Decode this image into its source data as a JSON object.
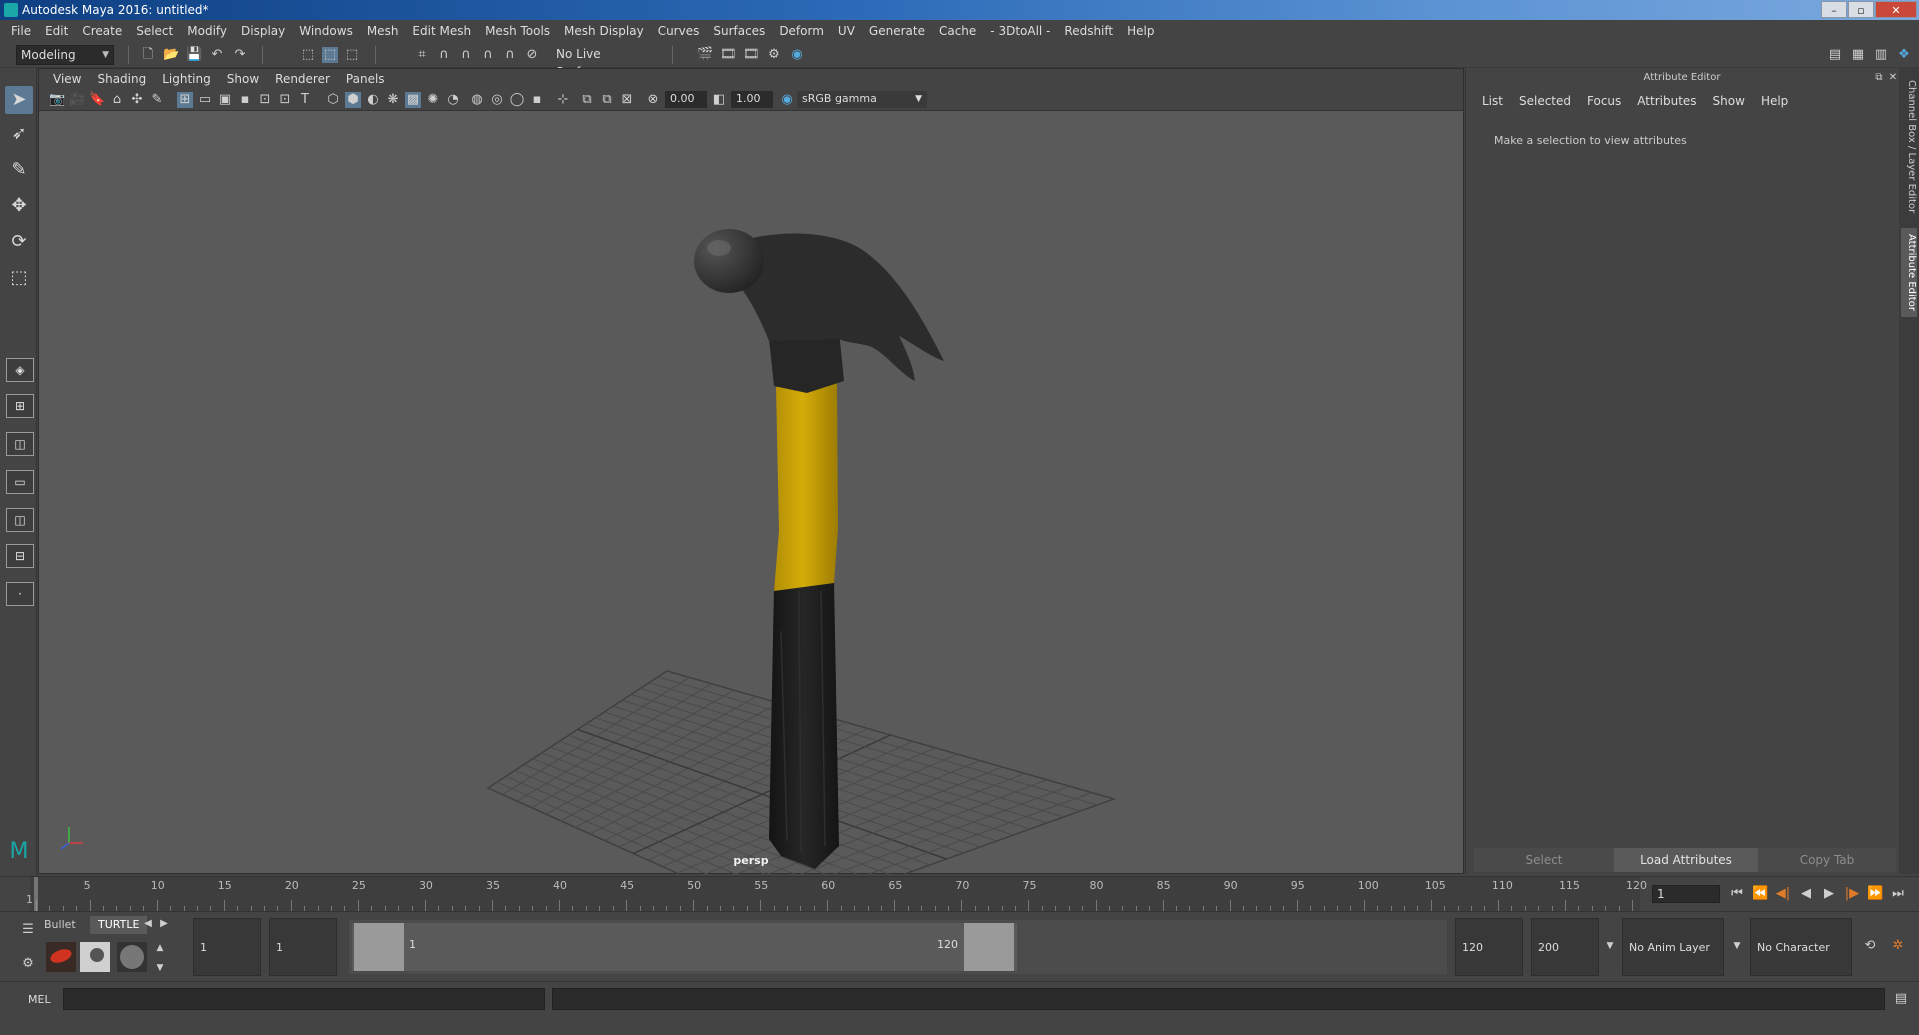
{
  "window": {
    "title": "Autodesk Maya 2016: untitled*",
    "buttons": [
      "–",
      "▫",
      "✕"
    ]
  },
  "menubar": [
    "File",
    "Edit",
    "Create",
    "Select",
    "Modify",
    "Display",
    "Windows",
    "Mesh",
    "Edit Mesh",
    "Mesh Tools",
    "Mesh Display",
    "Curves",
    "Surfaces",
    "Deform",
    "UV",
    "Generate",
    "Cache",
    "- 3DtoAll -",
    "Redshift",
    "Help"
  ],
  "statusline": {
    "mode": "Modeling",
    "live_surface": "No Live Surface"
  },
  "viewport": {
    "menu": [
      "View",
      "Shading",
      "Lighting",
      "Show",
      "Renderer",
      "Panels"
    ],
    "exposure": "0.00",
    "gamma": "1.00",
    "color_space": "sRGB gamma",
    "camera": "persp"
  },
  "attribute_editor": {
    "title": "Attribute Editor",
    "menu": [
      "List",
      "Selected",
      "Focus",
      "Attributes",
      "Show",
      "Help"
    ],
    "message": "Make a selection to view attributes",
    "buttons": {
      "select": "Select",
      "load": "Load Attributes",
      "copy": "Copy Tab"
    }
  },
  "side_tabs": {
    "channel": "Channel Box / Layer Editor",
    "attribute": "Attribute Editor"
  },
  "timeslider": {
    "ticks": [
      "1",
      "5",
      "10",
      "15",
      "20",
      "25",
      "30",
      "35",
      "40",
      "45",
      "50",
      "55",
      "60",
      "65",
      "70",
      "75",
      "80",
      "85",
      "90",
      "95",
      "100",
      "105",
      "110",
      "115",
      "120"
    ],
    "current_frame": "1"
  },
  "range": {
    "shelf_tabs": [
      "Bullet",
      "TURTLE"
    ],
    "start_time": "1",
    "playback_start": "1",
    "range_start_label": "1",
    "range_end_label": "120",
    "playback_end": "120",
    "end_time": "200",
    "anim_layer": "No Anim Layer",
    "character_set": "No Character Set"
  },
  "cmdline": {
    "label": "MEL"
  },
  "colors": {
    "handle_yellow": "#d4ac08",
    "handle_black": "#1e1e1e",
    "head": "#2c2c2c"
  }
}
